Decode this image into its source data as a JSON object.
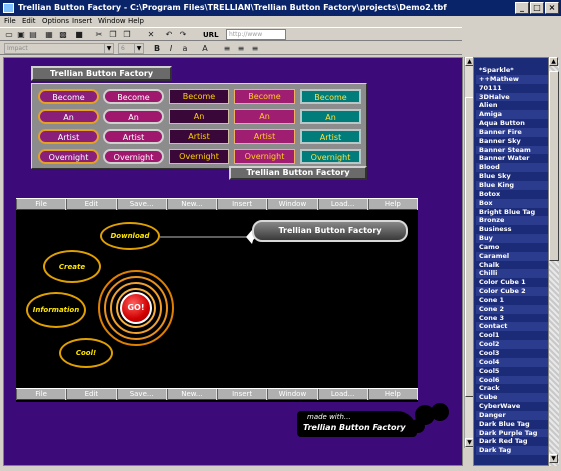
{
  "window": {
    "title": "Trellian Button Factory - C:\\Program Files\\TRELLIAN\\Trellian Button Factory\\projects\\Demo2.tbf"
  },
  "menu": [
    "File",
    "Edit",
    "Options",
    "Insert",
    "Window",
    "Help"
  ],
  "toolbar": {
    "url_label": "URL",
    "url_value": "http://www"
  },
  "format_bar": {
    "font": "Impact",
    "size": "6"
  },
  "grid": {
    "title": "Trellian Button Factory",
    "caption": "Trellian Button Factory",
    "rows": [
      [
        "Become",
        "Become",
        "Become",
        "Become",
        "Become"
      ],
      [
        "An",
        "An",
        "An",
        "An",
        "An"
      ],
      [
        "Artist",
        "Artist",
        "Artist",
        "Artist",
        "Artist"
      ],
      [
        "Overnight",
        "Overnight",
        "Overnight",
        "Overnight",
        "Overnight"
      ]
    ]
  },
  "demo": {
    "nav": [
      "File",
      "Edit",
      "Save...",
      "New...",
      "Insert",
      "Window",
      "Load...",
      "Help"
    ],
    "download": "Download",
    "create": "Create",
    "information": "Information",
    "cool": "Cool!",
    "go": "GO!",
    "banner": "Trellian Button Factory"
  },
  "made_with": {
    "line1": "made with...",
    "line2": "Trellian Button Factory"
  },
  "gallery": [
    "*Sparkle*",
    "++Mathew",
    "70111",
    "3DHalve",
    "Alien",
    "Amiga",
    "Aqua Button",
    "Banner Fire",
    "Banner Sky",
    "Banner Steam",
    "Banner Water",
    "Blood",
    "Blue Sky",
    "Blue King",
    "Botox",
    "Box",
    "Bright Blue Tag",
    "Bronze",
    "Business",
    "Buy",
    "Camo",
    "Caramel",
    "Chalk",
    "Chilli",
    "Color Cube 1",
    "Color Cube 2",
    "Cone 1",
    "Cone 2",
    "Cone 3",
    "Contact",
    "Cool1",
    "Cool2",
    "Cool3",
    "Cool4",
    "Cool5",
    "Cool6",
    "Crack",
    "Cube",
    "CyberWave",
    "Danger",
    "Dark Blue Tag",
    "Dark Purple Tag",
    "Dark Red Tag",
    "Dark Tag"
  ]
}
